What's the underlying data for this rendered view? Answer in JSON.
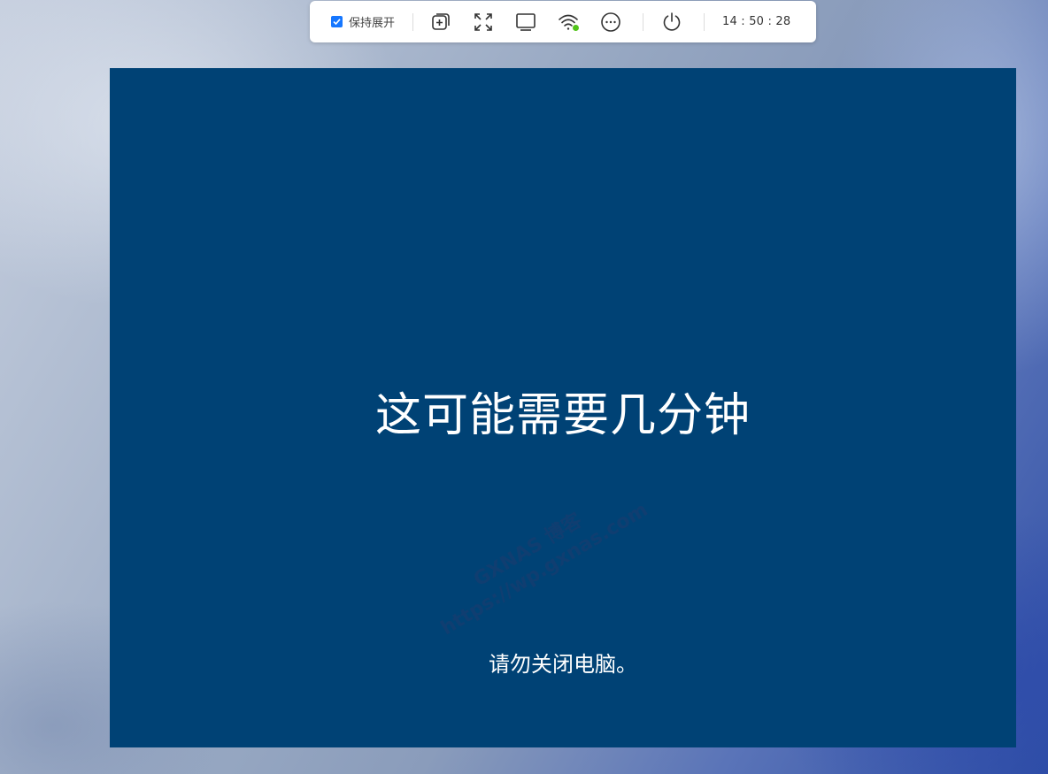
{
  "toolbar": {
    "keep_expanded": {
      "label": "保持展开",
      "checked": true
    },
    "buttons": [
      {
        "name": "add-window-icon"
      },
      {
        "name": "fullscreen-icon"
      },
      {
        "name": "display-icon"
      },
      {
        "name": "wifi-icon",
        "status_color": "#52c41a"
      },
      {
        "name": "more-icon"
      },
      {
        "name": "power-icon"
      }
    ],
    "clock": "14 : 50 : 28"
  },
  "remote_screen": {
    "background": "#004275",
    "main_message": "这可能需要几分钟",
    "sub_message": "请勿关闭电脑。"
  },
  "watermark": {
    "line1": "GXNAS 博客",
    "line2": "https://wp.gxnas.com"
  }
}
